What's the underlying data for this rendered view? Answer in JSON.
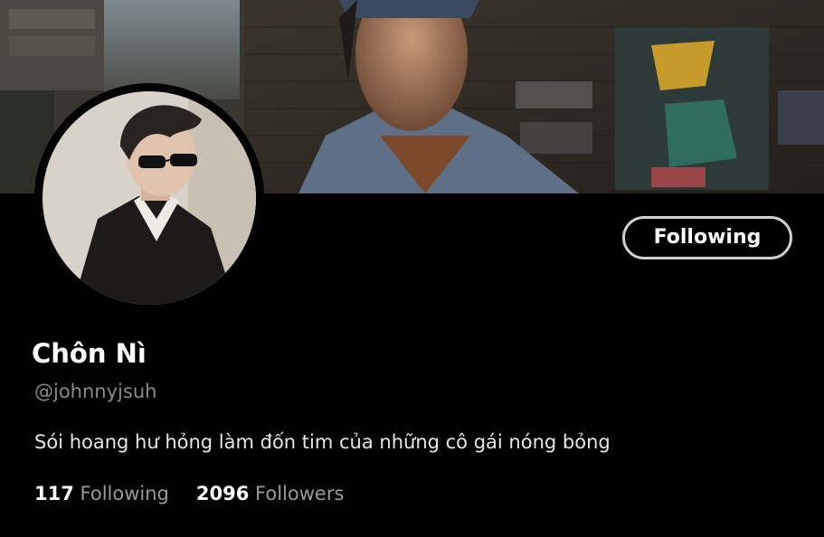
{
  "profile": {
    "display_name": "Chôn Nì",
    "handle": "@johnnyjsuh",
    "bio": "Sói hoang hư hỏng làm đốn tim của những cô gái nóng bỏng",
    "follow_button_label": "Following"
  },
  "stats": {
    "following_count": "117",
    "following_label": "Following",
    "followers_count": "2096",
    "followers_label": "Followers"
  },
  "colors": {
    "background": "#000000",
    "text_primary": "#ffffff",
    "text_secondary": "#8a8a8a",
    "button_border": "#cfcfcf"
  }
}
